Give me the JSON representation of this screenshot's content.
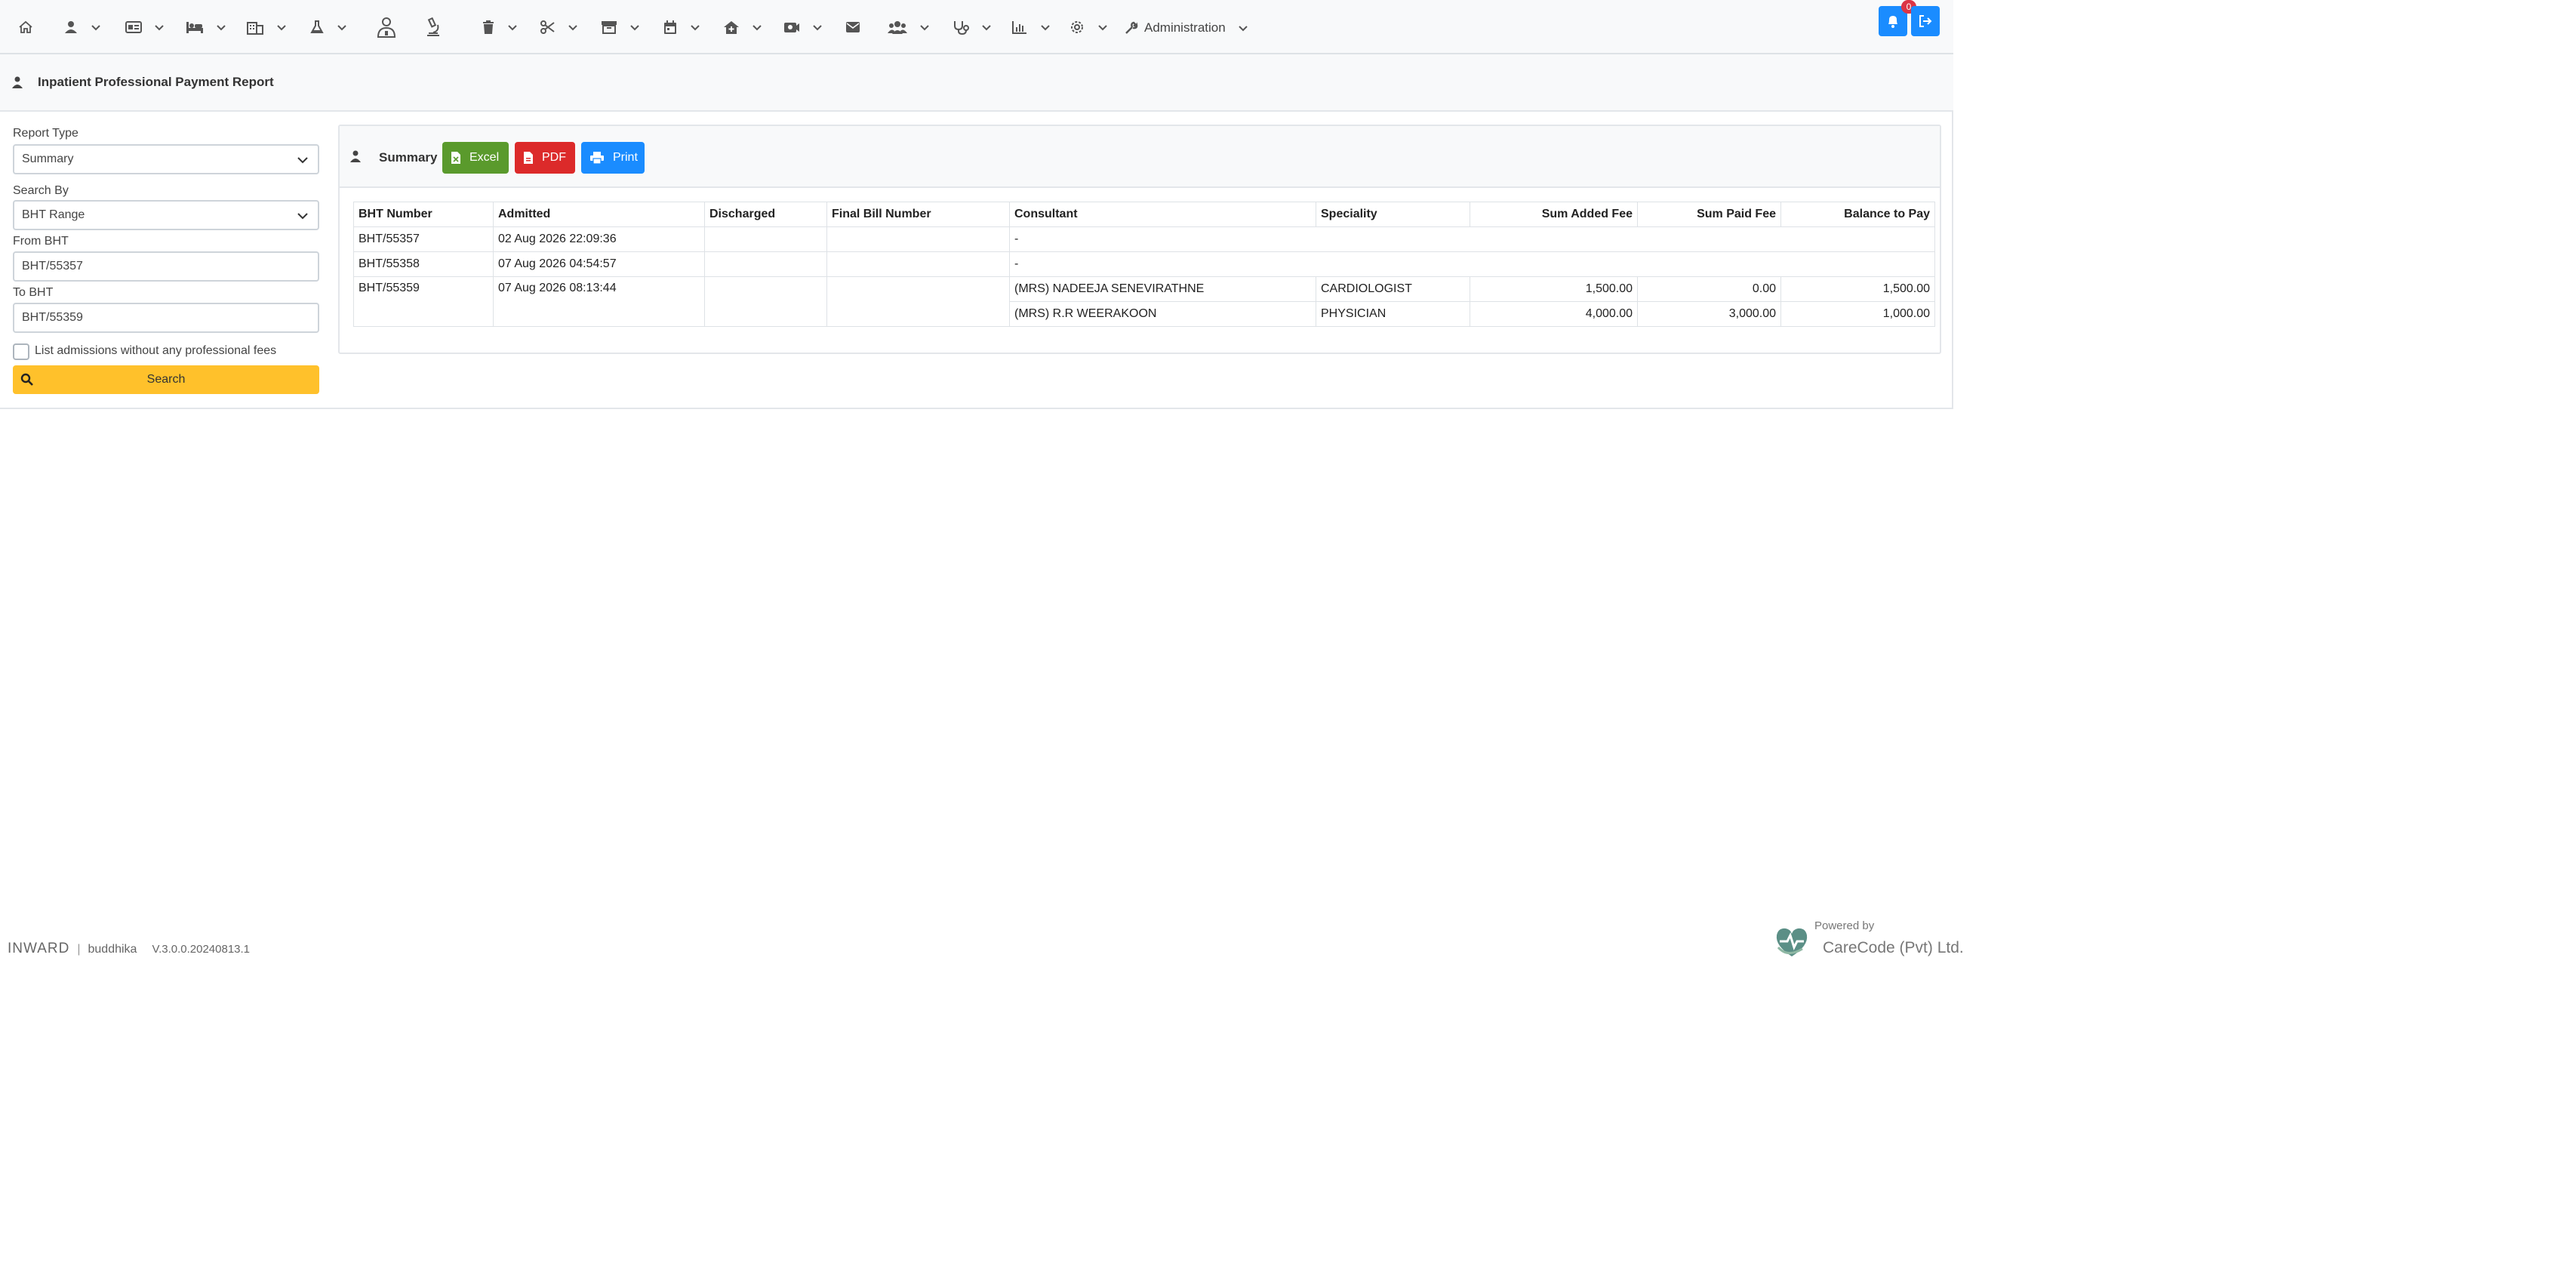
{
  "nav": {
    "icons": [
      "home-icon",
      "user-icon",
      "id-card-icon",
      "bed-icon",
      "building-icon",
      "flask-icon",
      "doctor-icon",
      "microscope-icon",
      "trash-icon",
      "scissors-icon",
      "archive-icon",
      "calendar-icon",
      "house-medical-icon",
      "video-icon",
      "envelope-icon",
      "users-icon",
      "stethoscope-icon",
      "chart-icon",
      "gear-icon"
    ],
    "admin_label": "Administration",
    "notification_count": "0"
  },
  "header": {
    "title": "Inpatient Professional Payment Report"
  },
  "form": {
    "report_type_label": "Report Type",
    "report_type_value": "Summary",
    "search_by_label": "Search By",
    "search_by_value": "BHT Range",
    "from_bht_label": "From BHT",
    "from_bht_value": "BHT/55357",
    "to_bht_label": "To BHT",
    "to_bht_value": "BHT/55359",
    "checkbox_label": "List admissions without any professional fees",
    "search_button": "Search"
  },
  "panel": {
    "title": "Summary",
    "excel_label": "Excel",
    "pdf_label": "PDF",
    "print_label": "Print"
  },
  "table": {
    "headers": [
      "BHT Number",
      "Admitted",
      "Discharged",
      "Final Bill Number",
      "Consultant",
      "Speciality",
      "Sum Added Fee",
      "Sum Paid Fee",
      "Balance to Pay"
    ],
    "rows": [
      {
        "bht": "BHT/55357",
        "admitted": "02 Aug 2026 22:09:36",
        "dash": "-"
      },
      {
        "bht": "BHT/55358",
        "admitted": "07 Aug 2026 04:54:57",
        "dash": "-"
      },
      {
        "bht": "BHT/55359",
        "admitted": "07 Aug 2026 08:13:44",
        "fees": [
          {
            "consultant": "(MRS) NADEEJA SENEVIRATHNE",
            "speciality": "CARDIOLOGIST",
            "added": "1,500.00",
            "paid": "0.00",
            "balance": "1,500.00"
          },
          {
            "consultant": "(MRS) R.R WEERAKOON",
            "speciality": "PHYSICIAN",
            "added": "4,000.00",
            "paid": "3,000.00",
            "balance": "1,000.00"
          }
        ]
      }
    ]
  },
  "footer": {
    "app": "INWARD",
    "user": "buddhika",
    "version": "V.3.0.0.20240813.1",
    "powered_by": "Powered by",
    "company": "CareCode (Pvt) Ltd."
  },
  "colors": {
    "excel": "#5a9a2c",
    "pdf": "#dc2a2a",
    "print": "#1a8cff",
    "search": "#ffc12b"
  }
}
